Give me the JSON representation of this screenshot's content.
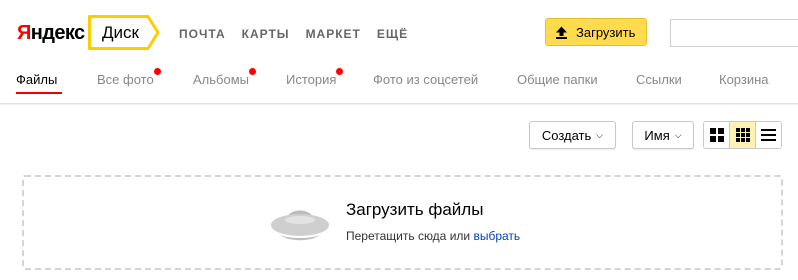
{
  "header": {
    "logo": {
      "first": "Я",
      "rest": "ндекс"
    },
    "service_name": "Диск",
    "nav": [
      "ПОЧТА",
      "КАРТЫ",
      "МАРКЕТ",
      "ЕЩЁ"
    ],
    "upload_label": "Загрузить",
    "search_value": ""
  },
  "tabs": [
    {
      "label": "Файлы",
      "active": true,
      "dot": false
    },
    {
      "label": "Все фото",
      "active": false,
      "dot": true
    },
    {
      "label": "Альбомы",
      "active": false,
      "dot": true
    },
    {
      "label": "История",
      "active": false,
      "dot": true
    },
    {
      "label": "Фото из соцсетей",
      "active": false,
      "dot": false
    },
    {
      "label": "Общие папки",
      "active": false,
      "dot": false
    },
    {
      "label": "Ссылки",
      "active": false,
      "dot": false
    },
    {
      "label": "Корзина",
      "active": false,
      "dot": false
    }
  ],
  "toolbar": {
    "create_label": "Создать",
    "sort_label": "Имя",
    "view_modes": [
      "large-tiles",
      "small-tiles",
      "list"
    ],
    "active_view": "small-tiles"
  },
  "dropzone": {
    "title": "Загрузить файлы",
    "subtitle_prefix": "Перетащить сюда или",
    "link": "выбрать"
  },
  "colors": {
    "accent_yellow": "#ffdb4d",
    "logo_red": "#ff0000",
    "active_tab_underline": "#ee0000",
    "notification_dot": "#ff0000",
    "link": "#0044bb"
  },
  "icons": {
    "upload": "upload-arrow-icon",
    "dropzone": "ufo-saucer-icon"
  }
}
